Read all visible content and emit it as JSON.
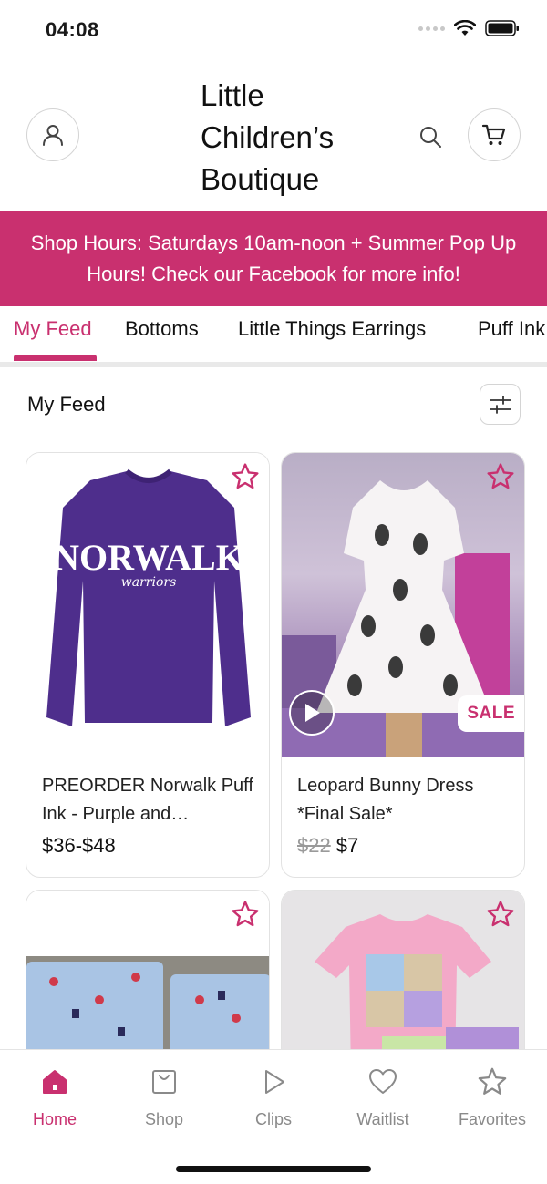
{
  "status_bar": {
    "time": "04:08"
  },
  "header": {
    "store_title": "Little Children’s Boutique",
    "account_icon": "user-icon",
    "search_icon": "search-icon",
    "cart_icon": "cart-icon"
  },
  "banner": {
    "text": "Shop Hours: Saturdays 10am-noon + Summer Pop Up Hours!  Check our Facebook for more info!"
  },
  "tabs": [
    {
      "label": "My Feed",
      "active": true
    },
    {
      "label": "Bottoms",
      "active": false
    },
    {
      "label": "Little Things Earrings",
      "active": false
    },
    {
      "label": "Puff Ink",
      "active": false
    }
  ],
  "feed": {
    "title": "My Feed",
    "filter_icon": "sliders-icon"
  },
  "products": [
    {
      "name": "PREORDER Norwalk Puff Ink - Purple and…",
      "price": "$36-$48",
      "old_price": "",
      "image_text": "NORWALK",
      "image_subtext": "warriors"
    },
    {
      "name": "Leopard Bunny Dress *Final Sale*",
      "price": "$7",
      "old_price": "$22",
      "badge": "SALE",
      "has_video": true
    },
    {
      "name": "",
      "price": ""
    },
    {
      "name": "",
      "price": ""
    }
  ],
  "bottom_nav": [
    {
      "label": "Home",
      "icon": "home-icon",
      "active": true
    },
    {
      "label": "Shop",
      "icon": "shopping-bag-icon",
      "active": false
    },
    {
      "label": "Clips",
      "icon": "play-icon",
      "active": false
    },
    {
      "label": "Waitlist",
      "icon": "heart-icon",
      "active": false
    },
    {
      "label": "Favorites",
      "icon": "star-icon",
      "active": false
    }
  ],
  "colors": {
    "accent": "#c9306f",
    "muted": "#8a8a8a",
    "border": "#e2e2e2"
  }
}
